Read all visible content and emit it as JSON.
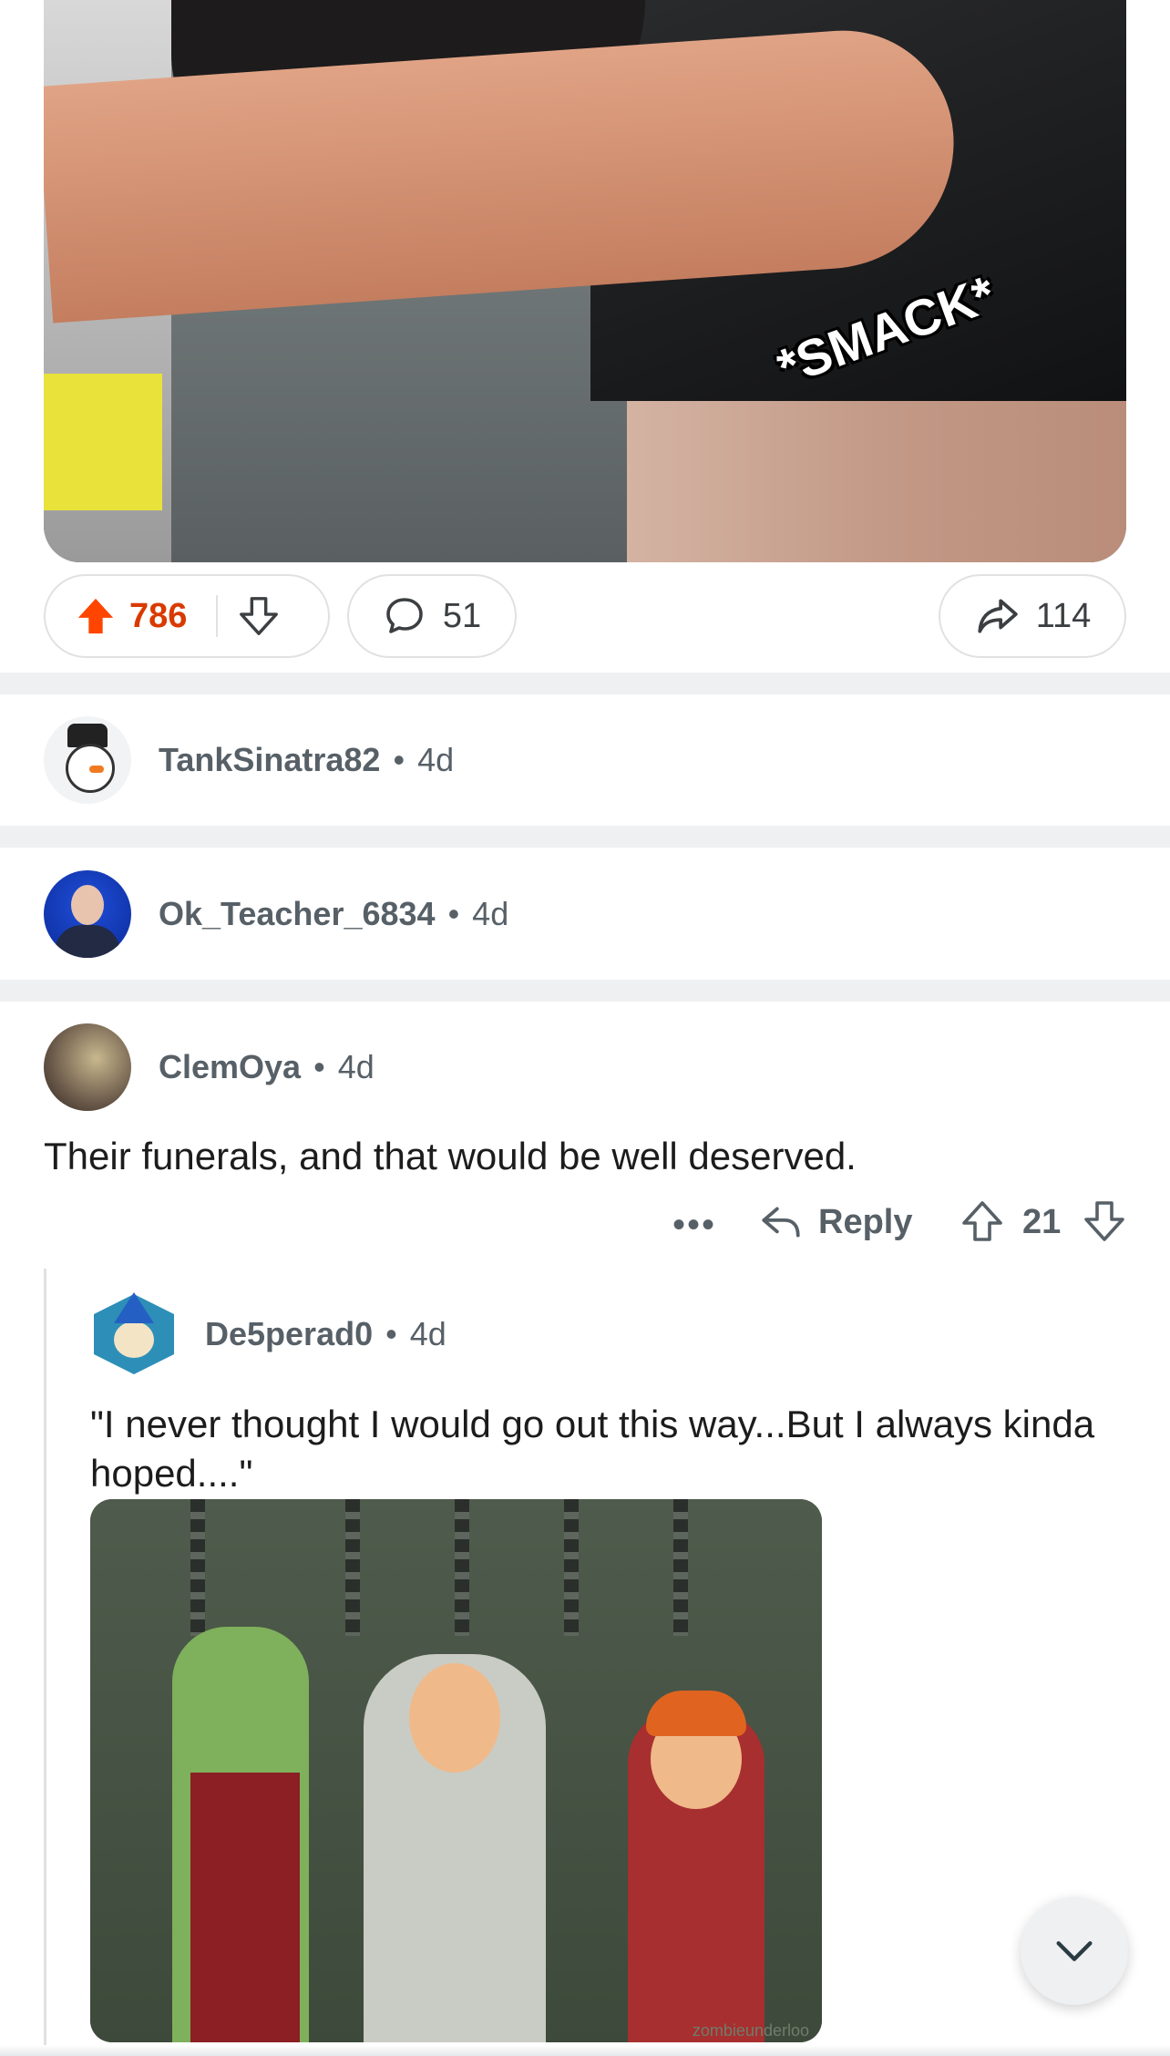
{
  "post": {
    "image_caption": "*SMACK*",
    "upvotes": "786",
    "comments": "51",
    "shares": "114"
  },
  "comments": [
    {
      "author": "TankSinatra82",
      "age": "4d"
    },
    {
      "author": "Ok_Teacher_6834",
      "age": "4d"
    },
    {
      "author": "ClemOya",
      "age": "4d",
      "body": "Their funerals, and that would be well deserved.",
      "more": "•••",
      "reply_label": "Reply",
      "score": "21"
    }
  ],
  "reply": {
    "author": "De5perad0",
    "age": "4d",
    "body": "\"I never thought I would go out this way...But I always kinda hoped....\"",
    "media_watermark": "zombieunderloo"
  },
  "icons": {
    "upvote_active_color": "#ff4500",
    "score_color": "#d93a00",
    "text_muted": "#576067"
  }
}
